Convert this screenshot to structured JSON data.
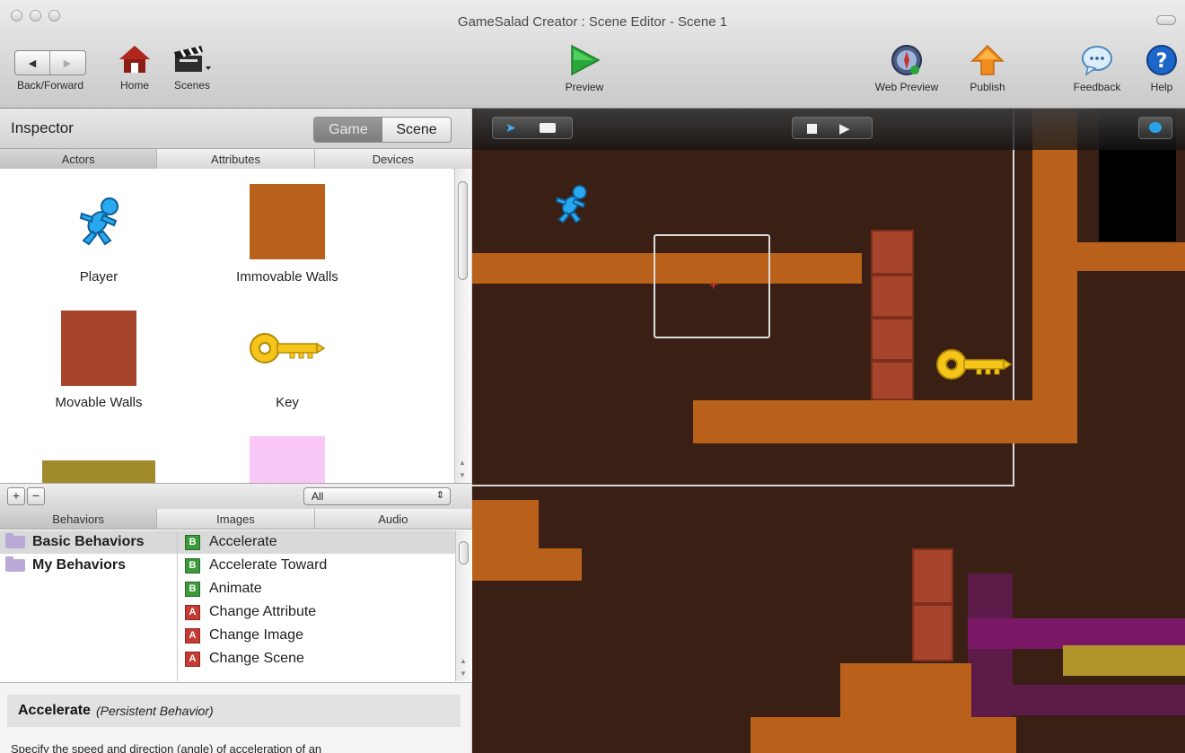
{
  "window": {
    "title": "GameSalad Creator : Scene Editor - Scene 1"
  },
  "toolbar": {
    "back_forward_label": "Back/Forward",
    "home_label": "Home",
    "scenes_label": "Scenes",
    "preview_label": "Preview",
    "web_preview_label": "Web Preview",
    "publish_label": "Publish",
    "feedback_label": "Feedback",
    "help_label": "Help"
  },
  "inspector": {
    "title": "Inspector",
    "mode_tabs": [
      "Game",
      "Scene"
    ],
    "active_mode": "Game",
    "tabs": [
      "Actors",
      "Attributes",
      "Devices"
    ],
    "actors": [
      {
        "label": "Player",
        "icon": "running-figure-icon"
      },
      {
        "label": "Immovable Walls",
        "color": "#b9611b"
      },
      {
        "label": "Movable Walls",
        "color": "#a6452b"
      },
      {
        "label": "Key",
        "icon": "key-icon"
      },
      {
        "label": "",
        "color": "#a08a2c"
      },
      {
        "label": "",
        "color": "#f9c8f7"
      }
    ],
    "add_button": "+",
    "remove_button": "−",
    "filter_value": "All"
  },
  "library": {
    "tabs": [
      "Behaviors",
      "Images",
      "Audio"
    ],
    "folders": [
      "Basic Behaviors",
      "My Behaviors"
    ],
    "behaviors": [
      {
        "badge": "B",
        "label": "Accelerate"
      },
      {
        "badge": "B",
        "label": "Accelerate Toward"
      },
      {
        "badge": "B",
        "label": "Animate"
      },
      {
        "badge": "A",
        "label": "Change Attribute"
      },
      {
        "badge": "A",
        "label": "Change Image"
      },
      {
        "badge": "A",
        "label": "Change Scene"
      }
    ]
  },
  "description": {
    "name": "Accelerate",
    "type": "(Persistent Behavior)",
    "text": "Specify the speed and direction (angle) of acceleration of an"
  },
  "colors": {
    "scene_bg": "#3a1f14",
    "immovable": "#b9611b",
    "movable": "#a6452b",
    "accent_blue": "#2aa4e8"
  }
}
